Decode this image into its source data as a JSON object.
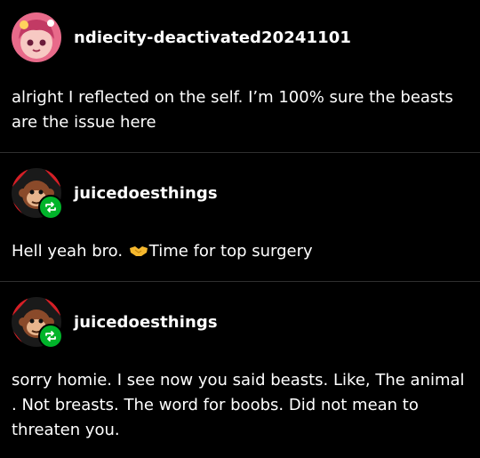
{
  "posts": [
    {
      "username": "ndiecity-deactivated20241101",
      "avatar_icon": "pink-anime-avatar",
      "reblog_badge": false,
      "text": "alright I reflected on the self. I’m 100% sure the beasts are the issue here"
    },
    {
      "username": "juicedoesthings",
      "avatar_icon": "monkey-avatar",
      "reblog_badge": true,
      "text_before": "Hell yeah bro. ",
      "emoji_icon": "handshake-emoji",
      "text_after": "Time for top surgery"
    },
    {
      "username": "juicedoesthings",
      "avatar_icon": "monkey-avatar",
      "reblog_badge": true,
      "text": "sorry homie. I see now you said beasts.  Like, The animal . Not breasts. The word for boobs. Did not mean to threaten you."
    }
  ],
  "colors": {
    "background": "#000000",
    "text": "#ffffff",
    "divider": "#2f2f2f",
    "reblog_badge": "#00b42a"
  }
}
